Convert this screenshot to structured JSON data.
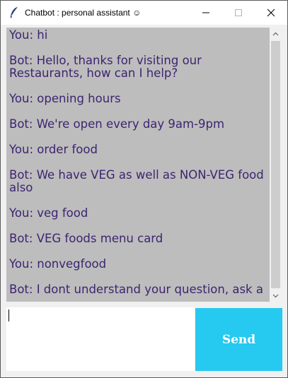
{
  "window": {
    "title": "Chatbot : personal assistant ☺",
    "minimize_glyph": "—",
    "maximize_glyph": "□",
    "close_glyph": "✕"
  },
  "chat": {
    "messages": [
      "You: hi",
      "Bot: Hello, thanks for visiting our Restaurants, how can I help?",
      "You: opening hours",
      "Bot: We're open every day 9am-9pm",
      "You: order food",
      "Bot: We have VEG as well as NON-VEG food also",
      "You: veg food",
      "Bot: VEG foods menu card",
      "You: nonvegfood",
      "Bot: I dont understand your question, ask a"
    ]
  },
  "input": {
    "value": ""
  },
  "send": {
    "label": "Send"
  },
  "colors": {
    "chat_background": "#bdbdbd",
    "chat_text": "#3d2470",
    "send_button": "#26c9f0"
  }
}
